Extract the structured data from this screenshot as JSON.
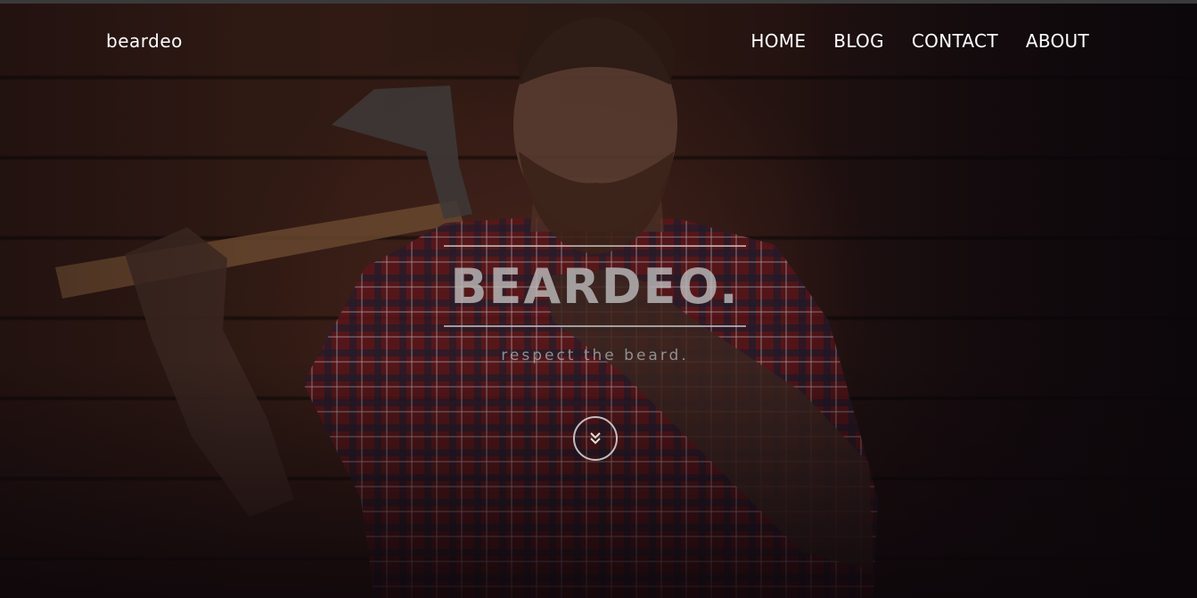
{
  "brand": {
    "name": "beardeo"
  },
  "nav": {
    "items": [
      {
        "label": "HOME"
      },
      {
        "label": "BLOG"
      },
      {
        "label": "CONTACT"
      },
      {
        "label": "ABOUT"
      }
    ]
  },
  "hero": {
    "title": "BEARDEO.",
    "tagline": "respect the beard.",
    "scroll_icon": "double-chevron-down-icon"
  },
  "colors": {
    "text": "#ffffff",
    "background": "#140d10",
    "wood": "#2f1913",
    "shirt_red": "#8a1d24"
  }
}
